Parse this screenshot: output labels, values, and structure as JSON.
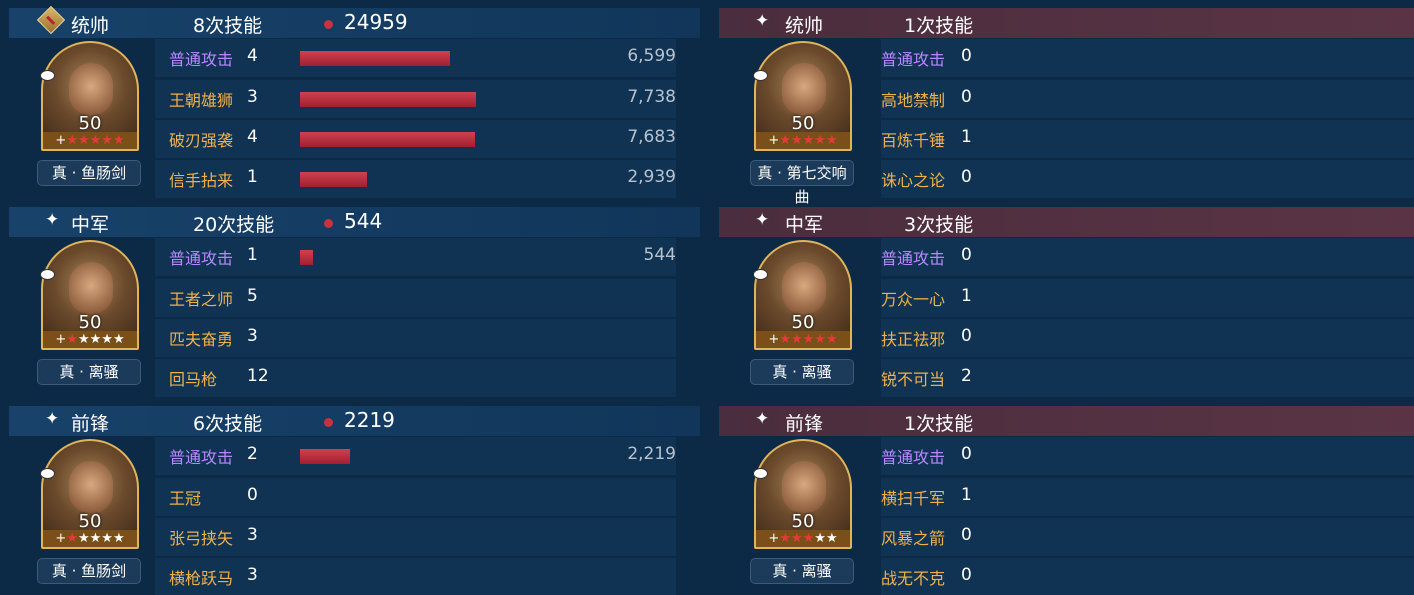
{
  "left": [
    {
      "role": "统帅",
      "skill_count": "8次技能",
      "total": "24959",
      "level": "50",
      "weapon": "真 · 鱼肠剑",
      "star_icon": "marshal-badge-icon",
      "stars_red": 5,
      "stars_total": 5,
      "skills": [
        {
          "name": "普通攻击",
          "level": "4",
          "damage": "6,599",
          "bar": 6599,
          "basic": true
        },
        {
          "name": "王朝雄狮",
          "level": "3",
          "damage": "7,738",
          "bar": 7738
        },
        {
          "name": "破刃强袭",
          "level": "4",
          "damage": "7,683",
          "bar": 7683
        },
        {
          "name": "信手拈来",
          "level": "1",
          "damage": "2,939",
          "bar": 2939
        }
      ]
    },
    {
      "role": "中军",
      "skill_count": "20次技能",
      "total": "544",
      "level": "50",
      "weapon": "真 · 离骚",
      "star_icon": "sparkle-icon",
      "stars_red": 1,
      "stars_total": 5,
      "skills": [
        {
          "name": "普通攻击",
          "level": "1",
          "damage": "544",
          "bar": 544,
          "basic": true
        },
        {
          "name": "王者之师",
          "level": "5",
          "damage": "",
          "bar": 0
        },
        {
          "name": "匹夫奋勇",
          "level": "3",
          "damage": "",
          "bar": 0
        },
        {
          "name": "回马枪",
          "level": "12",
          "damage": "",
          "bar": 0
        }
      ]
    },
    {
      "role": "前锋",
      "skill_count": "6次技能",
      "total": "2219",
      "level": "50",
      "weapon": "真 · 鱼肠剑",
      "star_icon": "sparkle-icon",
      "stars_red": 1,
      "stars_total": 5,
      "skills": [
        {
          "name": "普通攻击",
          "level": "2",
          "damage": "2,219",
          "bar": 2219,
          "basic": true
        },
        {
          "name": "王冠",
          "level": "0",
          "damage": "",
          "bar": 0
        },
        {
          "name": "张弓挟矢",
          "level": "3",
          "damage": "",
          "bar": 0
        },
        {
          "name": "横枪跃马",
          "level": "3",
          "damage": "",
          "bar": 0
        }
      ]
    }
  ],
  "right": [
    {
      "role": "统帅",
      "skill_count": "1次技能",
      "level": "50",
      "weapon": "真 · 第七交响曲",
      "star_icon": "sparkle-icon",
      "stars_red": 5,
      "stars_total": 5,
      "skills": [
        {
          "name": "普通攻击",
          "level": "0",
          "basic": true
        },
        {
          "name": "高地禁制",
          "level": "0"
        },
        {
          "name": "百炼千锤",
          "level": "1"
        },
        {
          "name": "诛心之论",
          "level": "0"
        }
      ]
    },
    {
      "role": "中军",
      "skill_count": "3次技能",
      "level": "50",
      "weapon": "真 · 离骚",
      "star_icon": "sparkle-icon",
      "stars_red": 5,
      "stars_total": 5,
      "skills": [
        {
          "name": "普通攻击",
          "level": "0",
          "basic": true
        },
        {
          "name": "万众一心",
          "level": "1"
        },
        {
          "name": "扶正祛邪",
          "level": "0"
        },
        {
          "name": "锐不可当",
          "level": "2"
        }
      ]
    },
    {
      "role": "前锋",
      "skill_count": "1次技能",
      "level": "50",
      "weapon": "真 · 离骚",
      "star_icon": "sparkle-icon",
      "stars_red": 3,
      "stars_total": 5,
      "skills": [
        {
          "name": "普通攻击",
          "level": "0",
          "basic": true
        },
        {
          "name": "横扫千军",
          "level": "1"
        },
        {
          "name": "风暴之箭",
          "level": "0"
        },
        {
          "name": "战无不克",
          "level": "0"
        }
      ]
    }
  ],
  "bar_max": 7738,
  "colors": {
    "bar": "#c8323e",
    "basic_skill": "#b988ff",
    "skill": "#f0b14a",
    "left_header": "#16406a",
    "right_header": "#4a2d3e"
  }
}
